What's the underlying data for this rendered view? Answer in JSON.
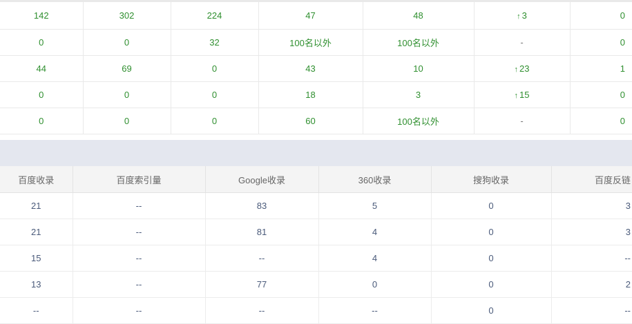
{
  "rank_table": {
    "rows": [
      {
        "c1": "142",
        "c2": "302",
        "c3": "224",
        "c4": "47",
        "c5": "48",
        "change": {
          "arrow": "↑",
          "value": "3"
        },
        "c7": "0"
      },
      {
        "c1": "0",
        "c2": "0",
        "c3": "32",
        "c4": "100名以外",
        "c5": "100名以外",
        "change": {
          "arrow": "",
          "value": "-"
        },
        "c7": "0"
      },
      {
        "c1": "44",
        "c2": "69",
        "c3": "0",
        "c4": "43",
        "c5": "10",
        "change": {
          "arrow": "↑",
          "value": "23"
        },
        "c7": "1"
      },
      {
        "c1": "0",
        "c2": "0",
        "c3": "0",
        "c4": "18",
        "c5": "3",
        "change": {
          "arrow": "↑",
          "value": "15"
        },
        "c7": "0"
      },
      {
        "c1": "0",
        "c2": "0",
        "c3": "0",
        "c4": "60",
        "c5": "100名以外",
        "change": {
          "arrow": "",
          "value": "-"
        },
        "c7": "0"
      }
    ],
    "colors": {
      "value_green": "#2f8f2f"
    }
  },
  "index_table": {
    "headers": {
      "baidu_indexed": "百度收录",
      "baidu_index_volume": "百度索引量",
      "google_indexed": "Google收录",
      "so360_indexed": "360收录",
      "sogou_indexed": "搜狗收录",
      "baidu_backlinks": "百度反链"
    },
    "rows": [
      {
        "baidu_indexed": "21",
        "baidu_index_volume": "--",
        "google_indexed": "83",
        "so360_indexed": "5",
        "sogou_indexed": "0",
        "baidu_backlinks": "3"
      },
      {
        "baidu_indexed": "21",
        "baidu_index_volume": "--",
        "google_indexed": "81",
        "so360_indexed": "4",
        "sogou_indexed": "0",
        "baidu_backlinks": "3"
      },
      {
        "baidu_indexed": "15",
        "baidu_index_volume": "--",
        "google_indexed": "--",
        "so360_indexed": "4",
        "sogou_indexed": "0",
        "baidu_backlinks": "--"
      },
      {
        "baidu_indexed": "13",
        "baidu_index_volume": "--",
        "google_indexed": "77",
        "so360_indexed": "0",
        "sogou_indexed": "0",
        "baidu_backlinks": "2"
      },
      {
        "baidu_indexed": "--",
        "baidu_index_volume": "--",
        "google_indexed": "--",
        "so360_indexed": "--",
        "sogou_indexed": "0",
        "baidu_backlinks": "--"
      }
    ],
    "colors": {
      "value_blue_gray": "#4a5a7a",
      "header_bg": "#f4f4f4"
    }
  },
  "separator": {
    "color": "#e4e7ef"
  }
}
